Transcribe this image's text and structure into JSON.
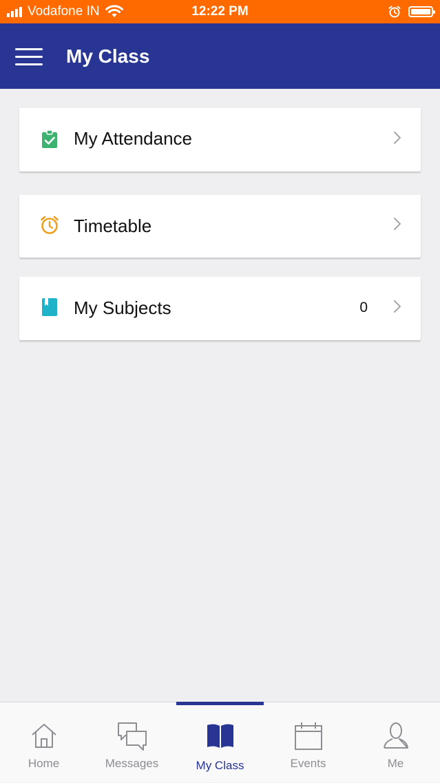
{
  "status_bar": {
    "carrier": "Vodafone IN",
    "time": "12:22 PM"
  },
  "header": {
    "title": "My Class"
  },
  "menu": {
    "items": [
      {
        "label": "My Attendance",
        "icon": "clipboard-check-icon",
        "icon_color": "#3cb371"
      },
      {
        "label": "Timetable",
        "icon": "alarm-clock-icon",
        "icon_color": "#f0a020"
      },
      {
        "label": "My Subjects",
        "icon": "book-icon",
        "icon_color": "#1fb3c9",
        "count": "0"
      }
    ]
  },
  "tab_bar": {
    "active": "My Class",
    "tabs": [
      {
        "label": "Home",
        "icon": "home-icon"
      },
      {
        "label": "Messages",
        "icon": "messages-icon"
      },
      {
        "label": "My Class",
        "icon": "book-open-icon"
      },
      {
        "label": "Events",
        "icon": "calendar-icon"
      },
      {
        "label": "Me",
        "icon": "user-icon"
      }
    ]
  },
  "colors": {
    "status_bar": "#ff6a00",
    "header": "#283593",
    "background": "#efeff1",
    "accent": "#283593"
  }
}
